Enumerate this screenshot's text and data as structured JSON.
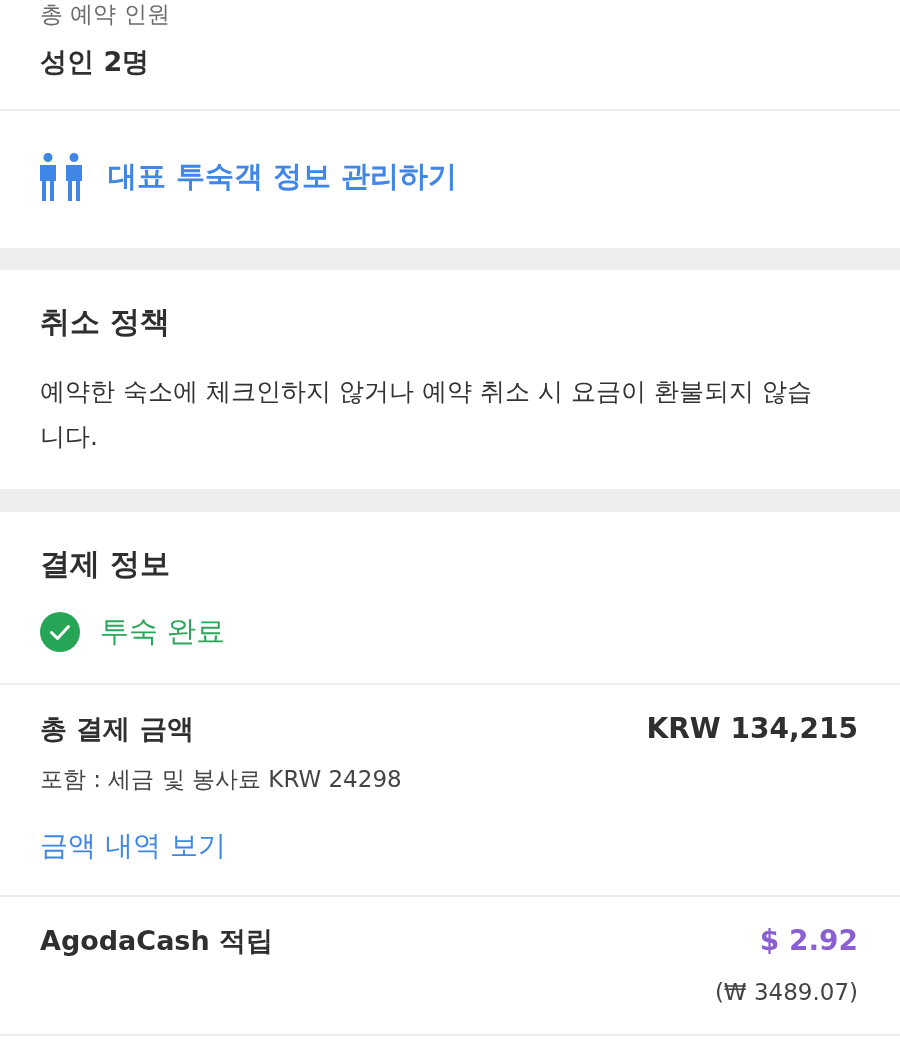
{
  "guests": {
    "label": "총 예약 인원",
    "value": "성인 2명"
  },
  "guest_info_link": {
    "label": "대표 투숙객 정보 관리하기"
  },
  "cancellation": {
    "title": "취소 정책",
    "text": "예약한 숙소에 체크인하지 않거나 예약 취소 시 요금이 환불되지 않습니다."
  },
  "payment": {
    "title": "결제 정보",
    "status": {
      "kind": "completed",
      "label": "투숙 완료"
    },
    "total": {
      "label": "총 결제 금액",
      "amount": "KRW 134,215",
      "note": "포함 : 세금 및 봉사료 KRW 24298",
      "link": "금액 내역 보기"
    },
    "cashback": {
      "label": "AgodaCash 적립",
      "amount": "$ 2.92",
      "converted": "(₩ 3489.07)"
    }
  }
}
